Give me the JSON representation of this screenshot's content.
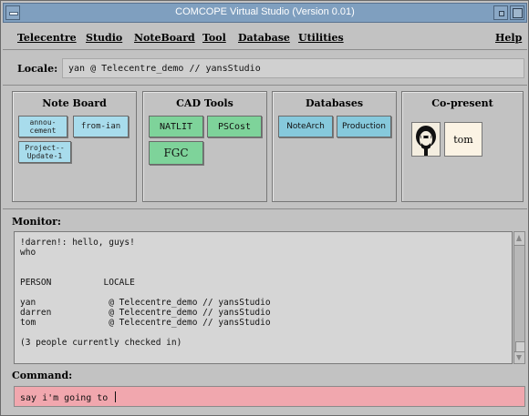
{
  "window": {
    "title": "COMCOPE Virtual Studio (Version 0.01)"
  },
  "menubar": {
    "items": [
      "Telecentre",
      "Studio",
      "NoteBoard",
      "Tool",
      "Database",
      "Utilities"
    ],
    "help": "Help"
  },
  "locale": {
    "label": "Locale:",
    "value": "yan @ Telecentre_demo // yansStudio"
  },
  "panels": {
    "noteboard": {
      "title": "Note Board",
      "buttons": [
        "annou-\ncement",
        "from-ian",
        "Project--\nUpdate-1"
      ]
    },
    "cad": {
      "title": "CAD Tools",
      "buttons": [
        "NATLIT",
        "PSCost",
        "FGC"
      ]
    },
    "databases": {
      "title": "Databases",
      "buttons": [
        "NoteArch",
        "Production"
      ]
    },
    "copresent": {
      "title": "Co-present",
      "people": [
        "tom"
      ]
    }
  },
  "monitor": {
    "label": "Monitor:",
    "lines": [
      "!darren!: hello, guys!",
      "who",
      "",
      "",
      "PERSON          LOCALE",
      "",
      "yan              @ Telecentre_demo // yansStudio",
      "darren           @ Telecentre_demo // yansStudio",
      "tom              @ Telecentre_demo // yansStudio",
      "",
      "(3 people currently checked in)"
    ]
  },
  "command": {
    "label": "Command:",
    "value": "say i'm going to "
  },
  "colors": {
    "titlebar": "#7f9fbf",
    "noteboard_button": "#a8dcec",
    "cad_button": "#7ed39a",
    "database_button": "#86c9dc",
    "command_field": "#f1a7ae"
  }
}
